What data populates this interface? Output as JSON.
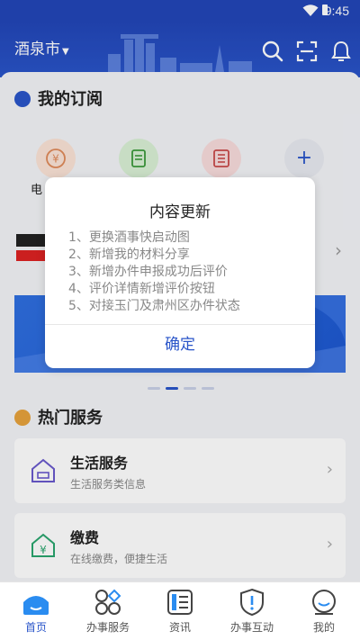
{
  "status_bar": {
    "time": "9:45"
  },
  "header": {
    "city": "酒泉市"
  },
  "subscription": {
    "title": "我的订阅",
    "first_label_partial": "电"
  },
  "modal": {
    "title": "内容更新",
    "items": [
      "1、更换酒事快启动图",
      "2、新增我的材料分享",
      "3、新增办件申报成功后评价",
      "4、评价详情新增评价按钮",
      "5、对接玉门及肃州区办件状态"
    ],
    "confirm": "确定"
  },
  "hot_services": {
    "title": "热门服务",
    "cards": [
      {
        "title": "生活服务",
        "desc": "生活服务类信息"
      },
      {
        "title": "缴费",
        "desc": "在线缴费，便捷生活"
      }
    ]
  },
  "tabbar": {
    "items": [
      {
        "label": "首页"
      },
      {
        "label": "办事服务"
      },
      {
        "label": "资讯"
      },
      {
        "label": "办事互动"
      },
      {
        "label": "我的"
      }
    ]
  },
  "colors": {
    "brand": "#2a55c9",
    "header": "#2246b8"
  }
}
